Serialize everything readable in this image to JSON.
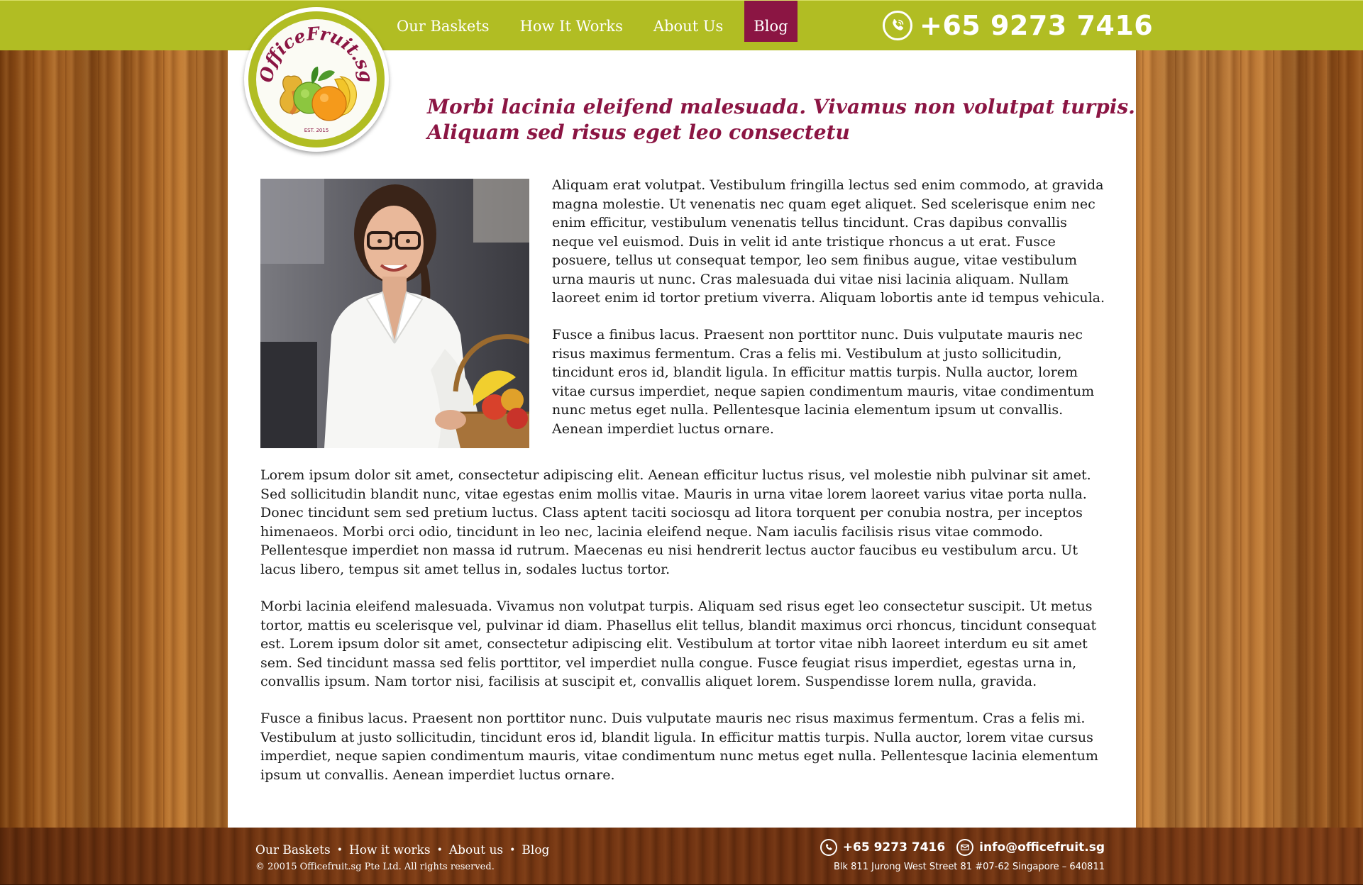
{
  "brand": {
    "logo_text": "OfficeFruit.sg",
    "logo_est": "EST. 2015",
    "colors": {
      "lime": "#b1bd23",
      "burgundy": "#8b1543",
      "white": "#ffffff"
    }
  },
  "nav": {
    "items": [
      {
        "label": "Our Baskets",
        "active": false
      },
      {
        "label": "How It Works",
        "active": false
      },
      {
        "label": "About Us",
        "active": false
      },
      {
        "label": "Blog",
        "active": true
      }
    ]
  },
  "header": {
    "phone_icon": "phone-icon",
    "phone": "+65 9273 7416"
  },
  "main": {
    "headline_line1": "Morbi lacinia eleifend malesuada. Vivamus non volutpat turpis.",
    "headline_line2": "Aliquam sed risus eget leo consectetu",
    "photo_description_icon": "woman-with-fruit-basket-photo",
    "paragraphs": [
      "Aliquam erat volutpat. Vestibulum fringilla lectus sed enim commodo, at gravida magna molestie. Ut venenatis nec quam eget aliquet. Sed scelerisque enim nec enim efficitur, vestibulum venenatis tellus tincidunt. Cras dapibus convallis neque vel euismod. Duis in velit id ante tristique rhoncus a ut erat. Fusce posuere, tellus ut consequat tempor, leo sem finibus augue, vitae vestibulum urna mauris ut nunc. Cras malesuada dui vitae nisi lacinia aliquam. Nullam laoreet enim id tortor pretium viverra. Aliquam lobortis ante id tempus vehicula.",
      "Fusce a finibus lacus. Praesent non porttitor nunc. Duis vulputate mauris nec risus maximus fermentum. Cras a felis mi. Vestibulum at justo sollicitudin, tincidunt eros id, blandit ligula. In efficitur mattis turpis. Nulla auctor, lorem vitae cursus imperdiet, neque sapien condimentum mauris, vitae condimentum nunc metus eget nulla. Pellentesque lacinia elementum ipsum ut convallis. Aenean imperdiet luctus ornare.",
      "Lorem ipsum dolor sit amet, consectetur adipiscing elit. Aenean efficitur luctus risus, vel molestie nibh pulvinar sit amet. Sed sollicitudin blandit nunc, vitae egestas enim mollis vitae. Mauris in urna vitae lorem laoreet varius vitae porta nulla. Donec tincidunt sem sed pretium luctus. Class aptent taciti sociosqu ad litora torquent per conubia nostra, per inceptos himenaeos. Morbi orci odio, tincidunt in leo nec, lacinia eleifend neque. Nam iaculis facilisis risus vitae commodo. Pellentesque imperdiet non massa id rutrum. Maecenas eu nisi hendrerit lectus auctor faucibus eu vestibulum arcu. Ut lacus libero, tempus sit amet tellus in, sodales luctus tortor.",
      "Morbi lacinia eleifend malesuada. Vivamus non volutpat turpis. Aliquam sed risus eget leo consectetur suscipit. Ut metus tortor, mattis eu scelerisque vel, pulvinar id diam. Phasellus elit tellus, blandit maximus orci rhoncus, tincidunt consequat est. Lorem ipsum dolor sit amet, consectetur adipiscing elit. Vestibulum at tortor vitae nibh laoreet interdum eu sit amet sem. Sed tincidunt massa sed felis porttitor, vel imperdiet nulla congue. Fusce feugiat risus imperdiet, egestas urna in, convallis ipsum. Nam tortor nisi, facilisis at suscipit et, convallis aliquet lorem. Suspendisse lorem nulla, gravida.",
      "Fusce a finibus lacus. Praesent non porttitor nunc. Duis vulputate mauris nec risus maximus fermentum. Cras a felis mi. Vestibulum at justo sollicitudin, tincidunt eros id, blandit ligula. In efficitur mattis turpis. Nulla auctor, lorem vitae cursus imperdiet, neque sapien condimentum mauris, vitae condimentum nunc metus eget nulla. Pellentesque lacinia elementum ipsum ut convallis. Aenean imperdiet luctus ornare."
    ]
  },
  "footer": {
    "links": [
      {
        "label": "Our Baskets"
      },
      {
        "label": "How it works"
      },
      {
        "label": "About us"
      },
      {
        "label": "Blog"
      }
    ],
    "separator": "•",
    "copyright": "© 20015 Officefruit.sg Pte Ltd. All rights reserved.",
    "phone_icon": "phone-icon",
    "phone": "+65 9273 7416",
    "email_icon": "email-icon",
    "email": "info@officefruit.sg",
    "address": "Blk 811 Jurong West Street 81 #07-62 Singapore – 640811"
  }
}
